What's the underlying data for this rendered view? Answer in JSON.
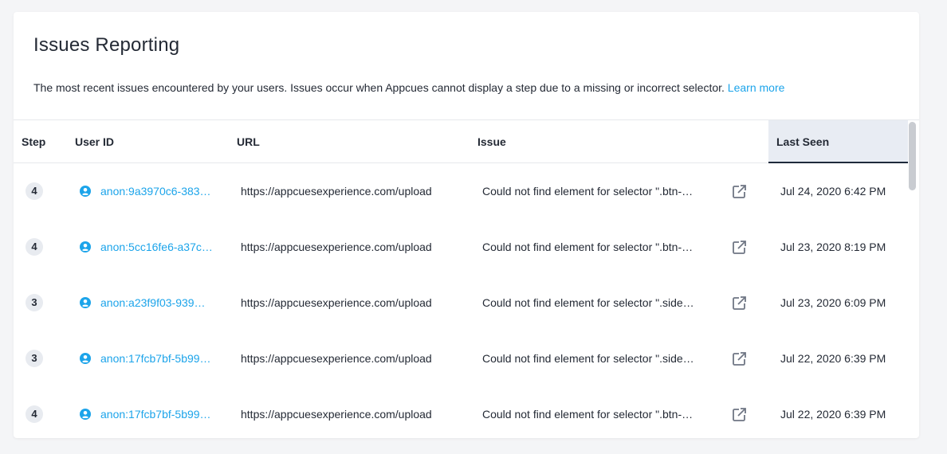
{
  "page": {
    "title": "Issues Reporting",
    "description": "The most recent issues encountered by your users. Issues occur when Appcues cannot display a step due to a missing or incorrect selector.",
    "learn_more": "Learn more"
  },
  "table": {
    "headers": {
      "step": "Step",
      "user_id": "User ID",
      "url": "URL",
      "issue": "Issue",
      "last_seen": "Last Seen"
    },
    "sorted_column": "last_seen",
    "rows": [
      {
        "step": "4",
        "user_id": "anon:9a3970c6-383…",
        "url": "https://appcuesexperience.com/upload",
        "issue": "Could not find element for selector \".btn-…",
        "last_seen": "Jul 24, 2020 6:42 PM"
      },
      {
        "step": "4",
        "user_id": "anon:5cc16fe6-a37c…",
        "url": "https://appcuesexperience.com/upload",
        "issue": "Could not find element for selector \".btn-…",
        "last_seen": "Jul 23, 2020 8:19 PM"
      },
      {
        "step": "3",
        "user_id": "anon:a23f9f03-939…",
        "url": "https://appcuesexperience.com/upload",
        "issue": "Could not find element for selector \".side…",
        "last_seen": "Jul 23, 2020 6:09 PM"
      },
      {
        "step": "3",
        "user_id": "anon:17fcb7bf-5b99…",
        "url": "https://appcuesexperience.com/upload",
        "issue": "Could not find element for selector \".side…",
        "last_seen": "Jul 22, 2020 6:39 PM"
      },
      {
        "step": "4",
        "user_id": "anon:17fcb7bf-5b99…",
        "url": "https://appcuesexperience.com/upload",
        "issue": "Could not find element for selector \".btn-…",
        "last_seen": "Jul 22, 2020 6:39 PM"
      }
    ]
  },
  "icons": {
    "user": "user-circle-icon",
    "external": "external-link-icon"
  },
  "colors": {
    "link": "#1ca4ea",
    "text": "#242a35",
    "header_active_bg": "#e8ecf3",
    "badge_bg": "#e8ebf0",
    "icon_gray": "#6f7684"
  }
}
